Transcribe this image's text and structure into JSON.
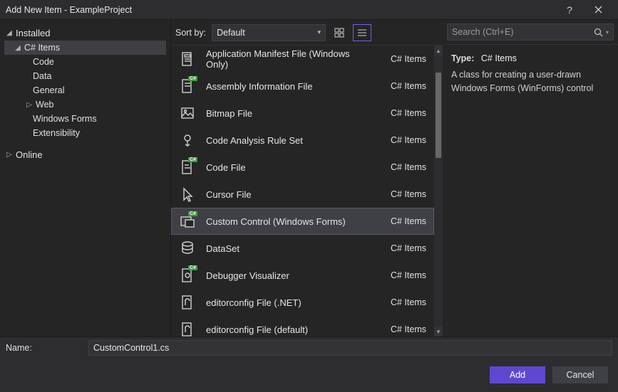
{
  "window": {
    "title": "Add New Item - ExampleProject",
    "help_label": "?",
    "close_label": "✕"
  },
  "tree": {
    "installed": "Installed",
    "csharp": "C# Items",
    "code": "Code",
    "data": "Data",
    "general": "General",
    "web": "Web",
    "winforms": "Windows Forms",
    "extensibility": "Extensibility",
    "online": "Online"
  },
  "toolbar": {
    "sort_by": "Sort by:",
    "sort_value": "Default"
  },
  "items": [
    {
      "label": "Application Manifest File (Windows Only)",
      "cat": "C# Items",
      "icon": "manifest"
    },
    {
      "label": "Assembly Information File",
      "cat": "C# Items",
      "icon": "assembly"
    },
    {
      "label": "Bitmap File",
      "cat": "C# Items",
      "icon": "bitmap"
    },
    {
      "label": "Code Analysis Rule Set",
      "cat": "C# Items",
      "icon": "ruleset"
    },
    {
      "label": "Code File",
      "cat": "C# Items",
      "icon": "codefile"
    },
    {
      "label": "Cursor File",
      "cat": "C# Items",
      "icon": "cursor"
    },
    {
      "label": "Custom Control (Windows Forms)",
      "cat": "C# Items",
      "icon": "customcontrol",
      "selected": true
    },
    {
      "label": "DataSet",
      "cat": "C# Items",
      "icon": "dataset"
    },
    {
      "label": "Debugger Visualizer",
      "cat": "C# Items",
      "icon": "debugvis"
    },
    {
      "label": "editorconfig File (.NET)",
      "cat": "C# Items",
      "icon": "editorconfig"
    },
    {
      "label": "editorconfig File (default)",
      "cat": "C# Items",
      "icon": "editorconfig"
    }
  ],
  "search": {
    "placeholder": "Search (Ctrl+E)"
  },
  "details": {
    "type_label": "Type:",
    "type_value": "C# Items",
    "description": "A class for creating a user-drawn Windows Forms (WinForms) control"
  },
  "name_row": {
    "label": "Name:",
    "value": "CustomControl1.cs"
  },
  "footer": {
    "add": "Add",
    "cancel": "Cancel"
  }
}
